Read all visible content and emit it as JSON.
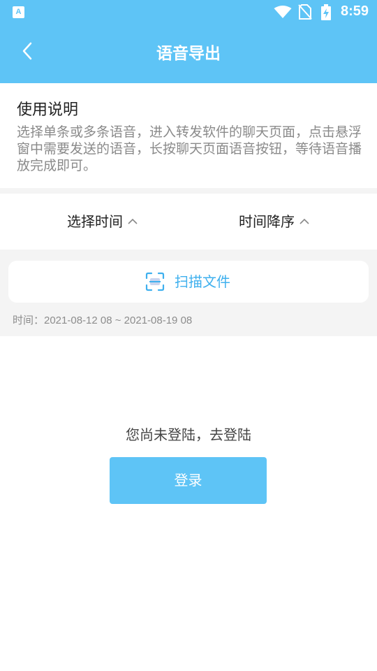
{
  "status_bar": {
    "app_icon_letter": "A",
    "time": "8:59",
    "icons": [
      "wifi-icon",
      "no-sim-icon",
      "battery-charging-icon"
    ]
  },
  "nav": {
    "back_icon": "chevron-left-icon",
    "title": "语音导出"
  },
  "instructions": {
    "heading": "使用说明",
    "body": "选择单条或多条语音，进入转发软件的聊天页面，点击悬浮窗中需要发送的语音，长按聊天页面语音按钮，等待语音播放完成即可。"
  },
  "filters": {
    "time_label": "选择时间",
    "order_label": "时间降序",
    "chevron_icon": "chevron-up-icon"
  },
  "scan": {
    "icon": "scan-icon",
    "label": "扫描文件"
  },
  "time_range": "时间：2021-08-12 08 ~ 2021-08-19 08",
  "login": {
    "prompt": "您尚未登陆，去登陆",
    "button_label": "登录"
  },
  "colors": {
    "primary": "#5ec4f6",
    "accent_text": "#3fb0ee",
    "muted_text": "#8a8a8a",
    "background_gray": "#f4f4f4"
  }
}
